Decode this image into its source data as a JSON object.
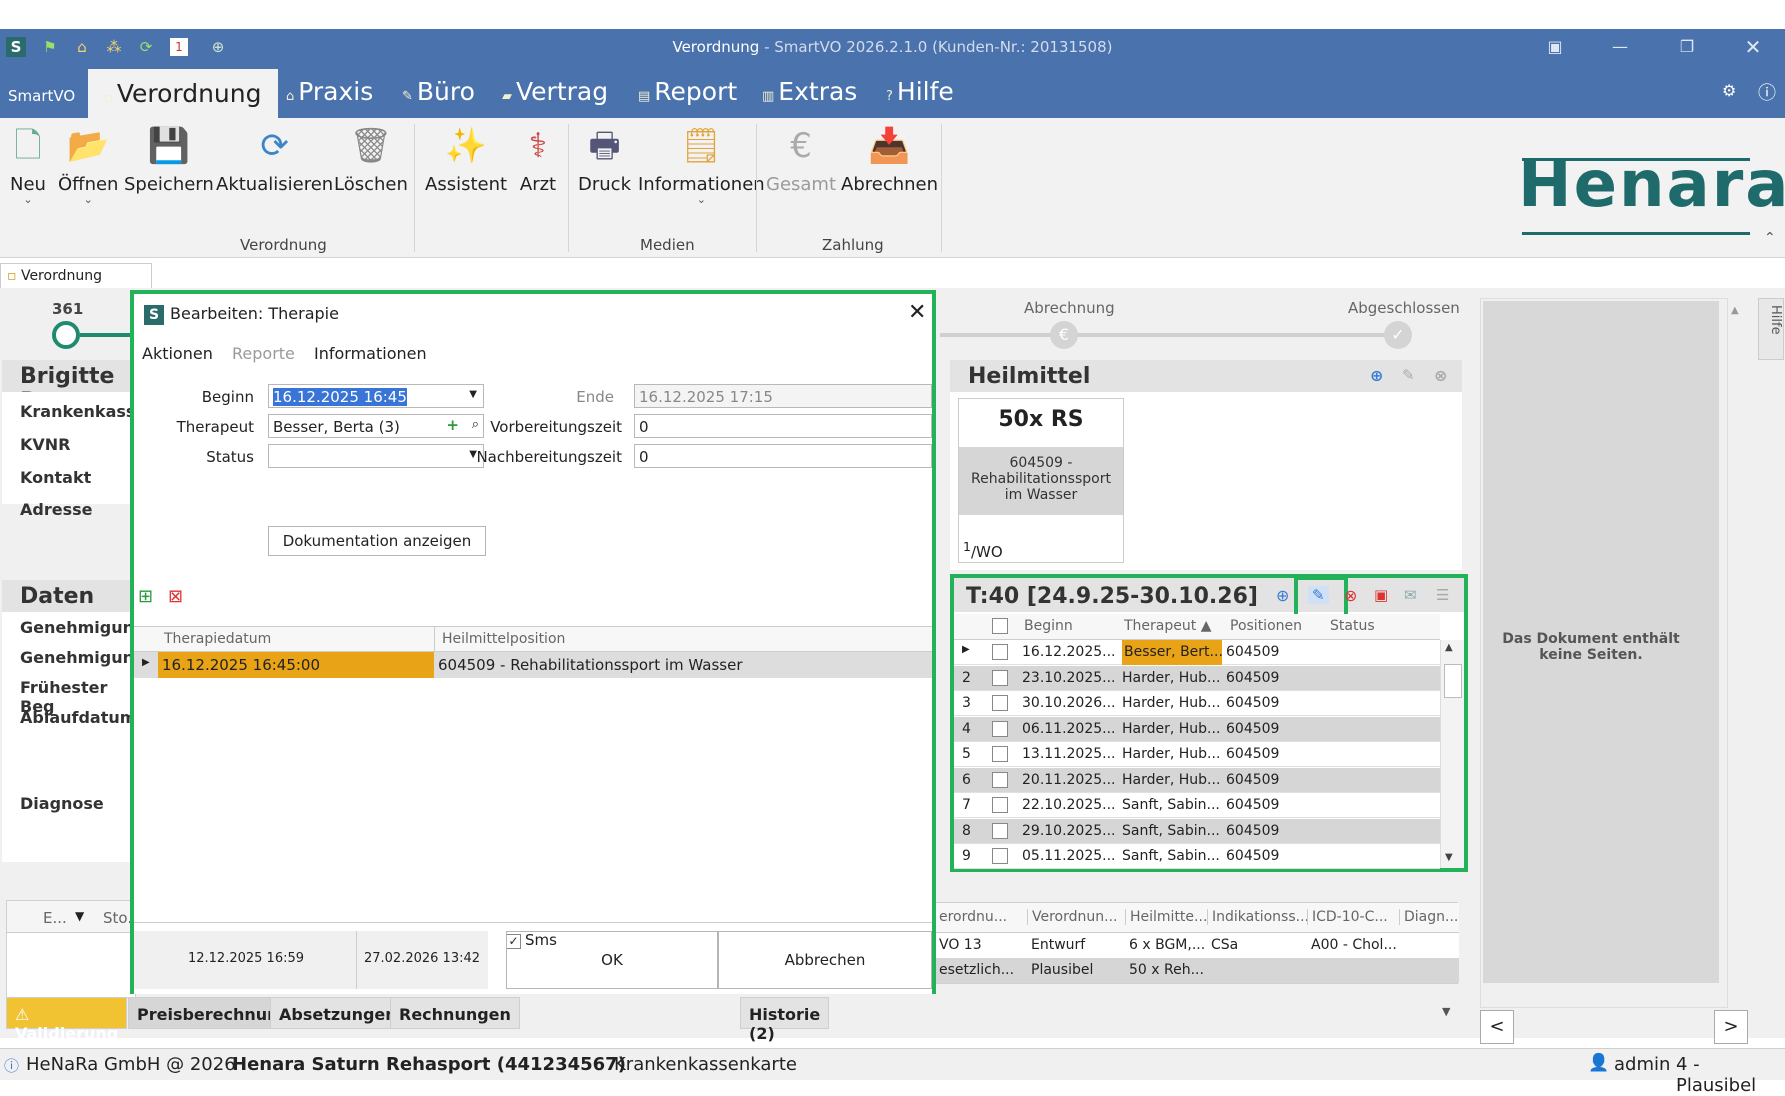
{
  "window": {
    "title": "Verordnung",
    "title_rest": " - SmartVO 2026.2.1.0 (Kunden-Nr.: 20131508)"
  },
  "menu": {
    "smartvo": "SmartVO",
    "tabs": [
      "Verordnung",
      "Praxis",
      "Büro",
      "Vertrag",
      "Report",
      "Extras",
      "Hilfe"
    ]
  },
  "ribbon": {
    "buttons": [
      "Neu",
      "Öffnen",
      "Speichern",
      "Aktualisieren",
      "Löschen",
      "Assistent",
      "Arzt",
      "Druck",
      "Informationen",
      "Gesamt",
      "Abrechnen"
    ],
    "groups": [
      "Verordnung",
      "Medien",
      "Zahlung"
    ]
  },
  "brand": "Henara",
  "doc_tab": "Verordnung",
  "progress": {
    "count": "361",
    "steps": [
      "Abrechnung",
      "Abgeschlossen"
    ]
  },
  "patient": {
    "name": "Brigitte Be",
    "labels": [
      "Krankenkasse",
      "KVNR",
      "Kontakt",
      "Adresse"
    ]
  },
  "daten": {
    "title": "Daten",
    "labels": [
      "Genehmigung",
      "Genehmigung",
      "Frühester Beg",
      "Ablaufdatum",
      "Diagnose"
    ]
  },
  "heilmittel": {
    "title": "Heilmittel",
    "card_title": "50x RS",
    "card_desc": "604509 - Rehabilitationssport im Wasser",
    "card_freq_sup": "1",
    "card_freq": "/WO"
  },
  "termine": {
    "title": "T:40 [24.9.25-30.10.26]",
    "headers": [
      "Beginn",
      "Therapeut",
      "Positionen",
      "Status"
    ],
    "rows": [
      {
        "n": "",
        "beginn": "16.12.2025...",
        "therapeut": "Besser, Bert...",
        "pos": "604509"
      },
      {
        "n": "2",
        "beginn": "23.10.2025...",
        "therapeut": "Harder, Hub...",
        "pos": "604509"
      },
      {
        "n": "3",
        "beginn": "30.10.2026...",
        "therapeut": "Harder, Hub...",
        "pos": "604509"
      },
      {
        "n": "4",
        "beginn": "06.11.2025...",
        "therapeut": "Harder, Hub...",
        "pos": "604509"
      },
      {
        "n": "5",
        "beginn": "13.11.2025...",
        "therapeut": "Harder, Hub...",
        "pos": "604509"
      },
      {
        "n": "6",
        "beginn": "20.11.2025...",
        "therapeut": "Harder, Hub...",
        "pos": "604509"
      },
      {
        "n": "7",
        "beginn": "22.10.2025...",
        "therapeut": "Sanft, Sabin...",
        "pos": "604509"
      },
      {
        "n": "8",
        "beginn": "29.10.2025...",
        "therapeut": "Sanft, Sabin...",
        "pos": "604509"
      },
      {
        "n": "9",
        "beginn": "05.11.2025...",
        "therapeut": "Sanft, Sabin...",
        "pos": "604509"
      }
    ]
  },
  "docview": {
    "empty": "Das Dokument enthält keine Seiten.",
    "prev": "<",
    "next": ">",
    "hilfe": "Hilfe"
  },
  "vo_table": {
    "headers": [
      "erordnu...",
      "Verordnun...",
      "Heilmitte...",
      "Indikationss...",
      "ICD-10-C...",
      "Diagn..."
    ],
    "rows": [
      [
        "VO 13",
        "Entwurf",
        "6 x BGM,...",
        "CSa",
        "A00 - Chol...",
        ""
      ],
      [
        "esetzlich...",
        "Plausibel",
        "50 x Reh...",
        "",
        "",
        ""
      ]
    ]
  },
  "left_grid": {
    "headers": [
      "E...",
      "Sto."
    ]
  },
  "bottom_tabs": [
    "Validierung",
    "Preisberechnung",
    "Absetzungen",
    "Rechnungen",
    "Historie (2)"
  ],
  "status": {
    "company": "HeNaRa GmbH @ 2026",
    "center": "Henara Saturn Rehasport (441234567)",
    "card": "Krankenkassenkarte",
    "user": "admin",
    "state": "4 - Plausibel"
  },
  "dialog": {
    "title": "Bearbeiten: Therapie",
    "menu": [
      "Aktionen",
      "Reporte",
      "Informationen"
    ],
    "beginn_label": "Beginn",
    "beginn_value": "16.12.2025 16:45",
    "therapeut_label": "Therapeut",
    "therapeut_value": "Besser, Berta (3)",
    "status_label": "Status",
    "status_value": "",
    "ende_label": "Ende",
    "ende_value": "16.12.2025 17:15",
    "vorb_label": "Vorbereitungszeit",
    "vorb_value": "0",
    "nachb_label": "Nachbereitungszeit",
    "nachb_value": "0",
    "doc_button": "Dokumentation anzeigen",
    "grid_headers": [
      "Therapiedatum",
      "Heilmittelposition"
    ],
    "grid_row": {
      "date": "16.12.2025 16:45:00",
      "pos": "604509 - Rehabilitationssport im Wasser"
    },
    "created": "12.12.2025 16:59",
    "modified": "27.02.2026 13:42",
    "sms": "Sms",
    "ok": "OK",
    "cancel": "Abbrechen"
  },
  "colors": {
    "titlebar": "#4a72ad",
    "accent_green": "#22b35a",
    "highlight": "#e8a317",
    "brand": "#1f6b6b"
  }
}
